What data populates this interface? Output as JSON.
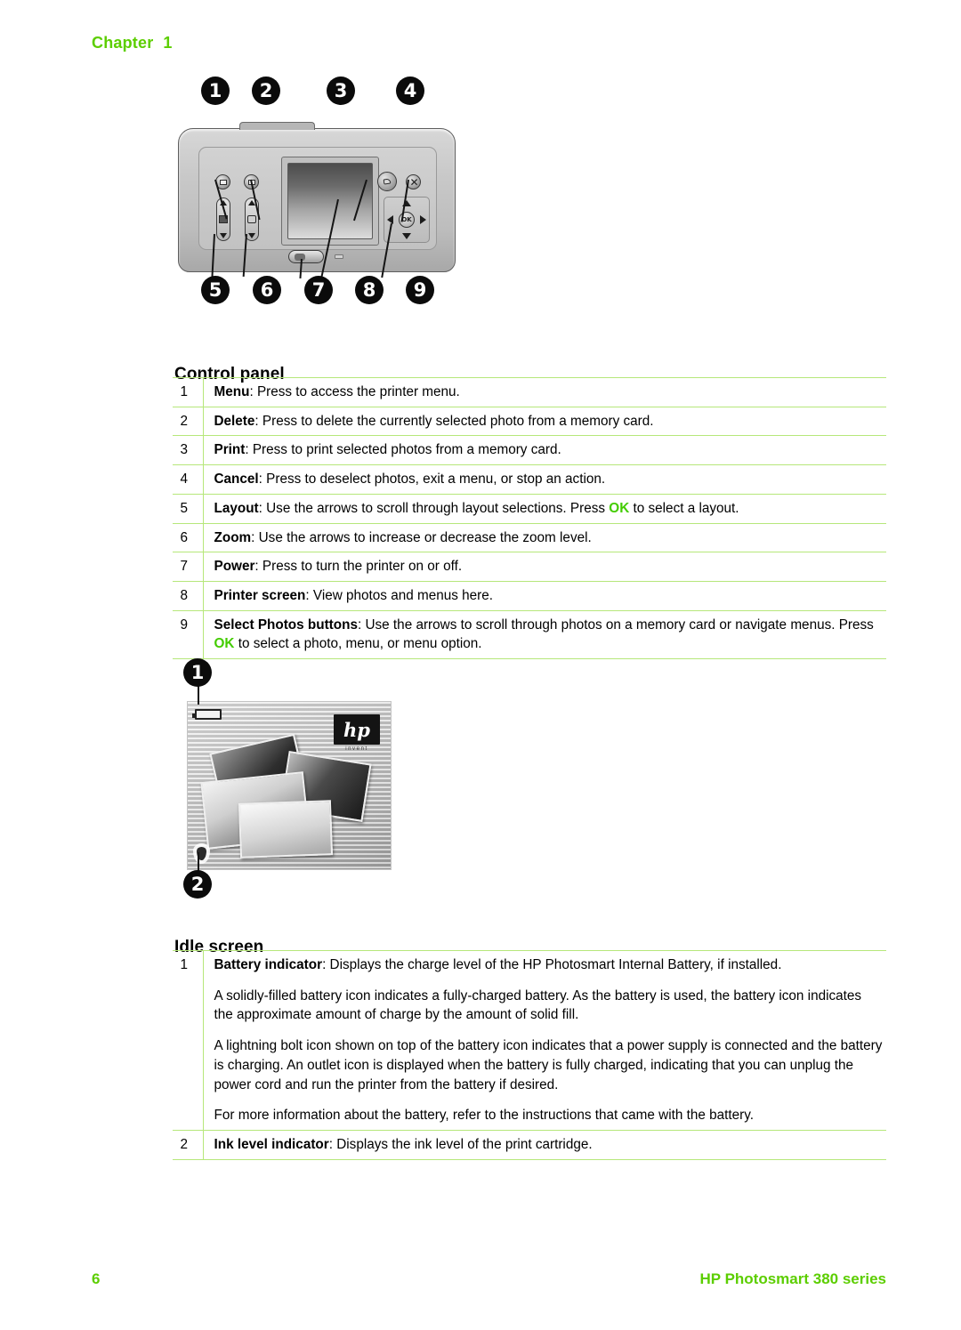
{
  "header": {
    "chapter_label": "Chapter",
    "chapter_number": "1"
  },
  "figures": {
    "control_panel": {
      "name": "printer-control-panel-diagram",
      "callouts": [
        "1",
        "2",
        "3",
        "4",
        "5",
        "6",
        "7",
        "8",
        "9"
      ],
      "parts": {
        "menu_button": "menu-button",
        "delete_button": "delete-button",
        "print_button": "print-button",
        "cancel_button": "cancel-button",
        "layout_rocker": "layout-rocker",
        "zoom_rocker": "zoom-rocker",
        "power_button": "power-button",
        "printer_screen": "printer-screen",
        "select_photos_navpad": "select-photos-navpad",
        "ok_label": "OK"
      }
    },
    "idle_screen": {
      "name": "idle-screen-diagram",
      "callouts": [
        "1",
        "2"
      ],
      "logo_text": "hp",
      "logo_tagline": "invent"
    }
  },
  "sections": [
    {
      "heading": "Control panel",
      "rows": [
        {
          "num": "1",
          "term": "Menu",
          "rest": ": Press to access the printer menu."
        },
        {
          "num": "2",
          "term": "Delete",
          "rest": ": Press to delete the currently selected photo from a memory card."
        },
        {
          "num": "3",
          "term": "Print",
          "rest": ": Press to print selected photos from a memory card."
        },
        {
          "num": "4",
          "term": "Cancel",
          "rest": ": Press to deselect photos, exit a menu, or stop an action."
        },
        {
          "num": "5",
          "term": "Layout",
          "rest_a": ": Use the arrows to scroll through layout selections. Press ",
          "ok": "OK",
          "rest_b": " to select a layout."
        },
        {
          "num": "6",
          "term": "Zoom",
          "rest": ": Use the arrows to increase or decrease the zoom level."
        },
        {
          "num": "7",
          "term": "Power",
          "rest": ": Press to turn the printer on or off."
        },
        {
          "num": "8",
          "term": "Printer screen",
          "rest": ": View photos and menus here."
        },
        {
          "num": "9",
          "term": "Select Photos buttons",
          "rest_a": ": Use the arrows to scroll through photos on a memory card or navigate menus. Press ",
          "ok": "OK",
          "rest_b": " to select a photo, menu, or menu option."
        }
      ]
    },
    {
      "heading": "Idle screen",
      "rows": [
        {
          "num": "1",
          "term": "Battery indicator",
          "rest": ": Displays the charge level of the HP Photosmart Internal Battery, if installed.",
          "para2": "A solidly-filled battery icon indicates a fully-charged battery. As the battery is used, the battery icon indicates the approximate amount of charge by the amount of solid fill.",
          "para3": "A lightning bolt icon shown on top of the battery icon indicates that a power supply is connected and the battery is charging. An outlet icon is displayed when the battery is fully charged, indicating that you can unplug the power cord and run the printer from the battery if desired.",
          "para4": "For more information about the battery, refer to the instructions that came with the battery."
        },
        {
          "num": "2",
          "term": "Ink level indicator",
          "rest": ": Displays the ink level of the print cartridge."
        }
      ]
    }
  ],
  "footer": {
    "page_number": "6",
    "product_title": "HP Photosmart 380 series"
  },
  "colors": {
    "accent_green": "#5cce00",
    "rule_green": "#b6e77a",
    "ok_green": "#43cc00"
  }
}
